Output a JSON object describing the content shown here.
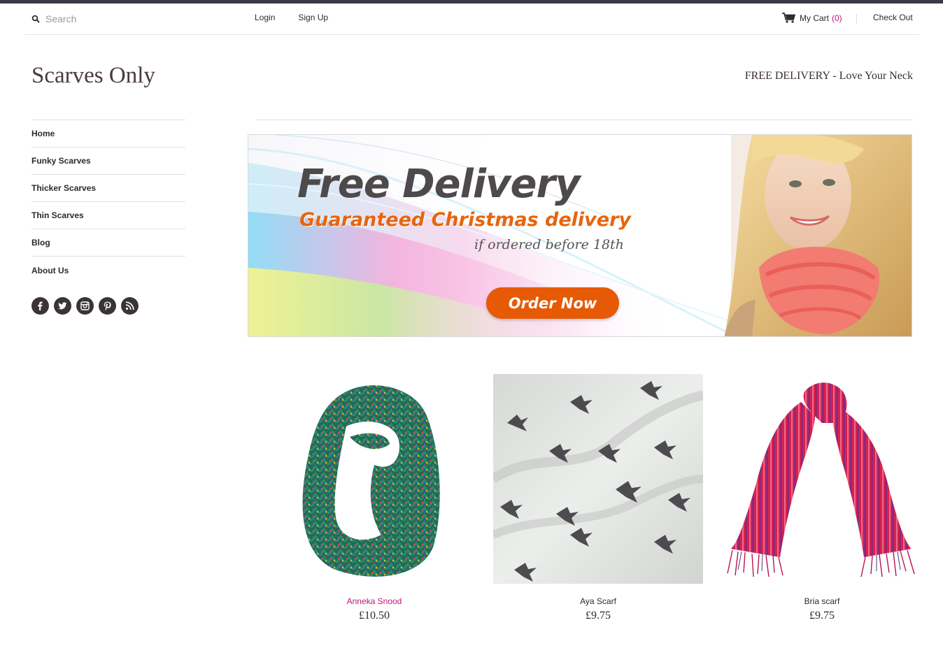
{
  "header": {
    "search_placeholder": "Search",
    "login": "Login",
    "signup": "Sign Up",
    "cart_label": "My Cart",
    "cart_count": "(0)",
    "checkout": "Check Out",
    "site_title": "Scarves Only",
    "tagline": "FREE DELIVERY - Love Your Neck"
  },
  "sidebar": {
    "items": [
      {
        "label": "Home"
      },
      {
        "label": "Funky Scarves"
      },
      {
        "label": "Thicker Scarves"
      },
      {
        "label": "Thin Scarves"
      },
      {
        "label": "Blog"
      },
      {
        "label": "About Us"
      }
    ],
    "social": [
      "facebook-icon",
      "twitter-icon",
      "instagram-icon",
      "pinterest-icon",
      "rss-icon"
    ]
  },
  "banner": {
    "headline": "Free Delivery",
    "subheadline": "Guaranteed Christmas delivery",
    "condition": "if ordered before 18th",
    "cta": "Order Now"
  },
  "products": [
    {
      "name": "Anneka Snood",
      "price": "£10.50"
    },
    {
      "name": "Aya Scarf",
      "price": "£9.75"
    },
    {
      "name": "Bria scarf",
      "price": "£9.75"
    }
  ],
  "colors": {
    "accent": "#c0157e",
    "text": "#2d2a2c",
    "top_stripe": "#3e3844",
    "cta": "#e65a05"
  }
}
